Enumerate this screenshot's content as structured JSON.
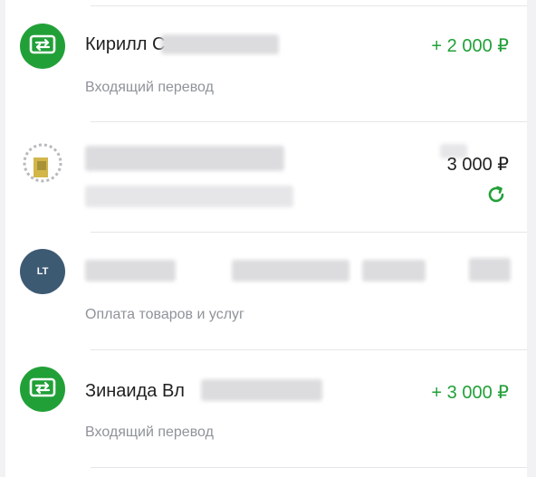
{
  "colors": {
    "accent_green": "#21a038",
    "subtitle_gray": "#8f9399",
    "divider": "#e6e6ea"
  },
  "transactions": [
    {
      "title": "Кирилл С",
      "subtitle": "Входящий перевод",
      "amount": "+ 2 000 ₽",
      "icon": "transfer-icon"
    },
    {
      "title": "",
      "subtitle": "",
      "amount": "3 000 ₽",
      "icon": "bank-logo-icon",
      "status_icon": "repeat-icon"
    },
    {
      "title": "",
      "subtitle": "Оплата товаров и услуг",
      "amount": "",
      "icon": "merchant-avatar",
      "avatar_text": "LT"
    },
    {
      "title": "Зинаида Вл",
      "subtitle": "Входящий перевод",
      "amount": "+ 3 000 ₽",
      "icon": "transfer-icon"
    }
  ]
}
